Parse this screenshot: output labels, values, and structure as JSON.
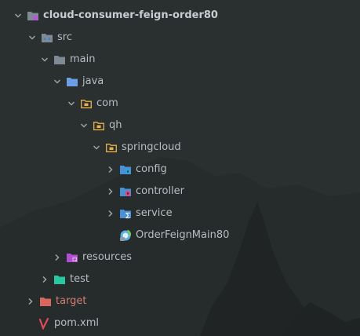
{
  "tree": {
    "project": {
      "label": "cloud-consumer-feign-order80"
    },
    "src": {
      "label": "src"
    },
    "main": {
      "label": "main"
    },
    "java": {
      "label": "java"
    },
    "com": {
      "label": "com"
    },
    "qh": {
      "label": "qh"
    },
    "springcloud": {
      "label": "springcloud"
    },
    "config": {
      "label": "config"
    },
    "controller": {
      "label": "controller"
    },
    "service": {
      "label": "service"
    },
    "mainclass": {
      "label": "OrderFeignMain80"
    },
    "resources": {
      "label": "resources"
    },
    "test": {
      "label": "test"
    },
    "target": {
      "label": "target"
    },
    "pom": {
      "label": "pom.xml"
    }
  },
  "icons": {
    "project": "module-folder-icon",
    "src": "source-folder-icon",
    "main": "folder-icon",
    "java": "source-root-folder-icon",
    "com": "package-folder-icon",
    "qh": "package-folder-icon",
    "springcloud": "package-folder-icon",
    "config": "config-folder-icon",
    "controller": "controller-folder-icon",
    "service": "service-folder-icon",
    "mainclass": "spring-class-icon",
    "resources": "resources-folder-icon",
    "test": "test-folder-icon",
    "target": "excluded-folder-icon",
    "pom": "maven-icon"
  },
  "colors": {
    "background": "#2a2f2f",
    "text": "#b6bdc4",
    "folder_grey": "#7e8a94",
    "folder_blue": "#6f9ee8",
    "package_outline": "#e8b04b",
    "target_red": "#d9675d",
    "test_green": "#29c6a0",
    "resources_purple": "#b04fd1",
    "maven_red": "#e04a5a"
  }
}
